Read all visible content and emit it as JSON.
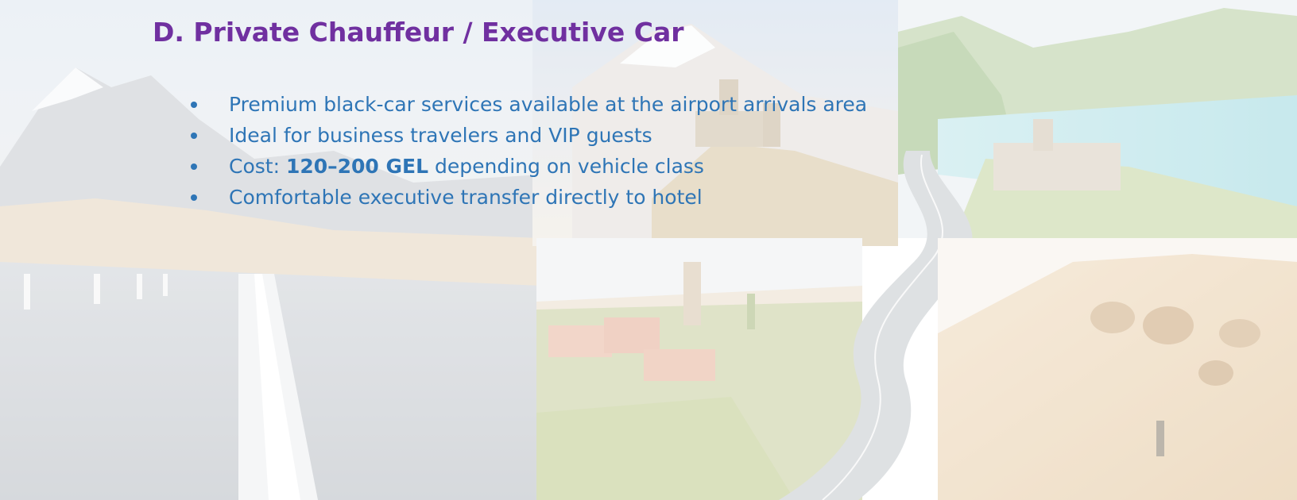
{
  "slide": {
    "title": "D. Private Chauffeur / Executive Car",
    "bullets": [
      "Premium black-car services available at the airport arrivals area",
      "Ideal for business travelers and VIP guests",
      {
        "prefix": "Cost: ",
        "emphasis": "120–200 GEL",
        "suffix": " depending on vehicle class"
      },
      "Comfortable executive transfer directly to hotel"
    ]
  },
  "colors": {
    "title": "#7030a0",
    "bullet_text": "#2e75b6"
  },
  "background": {
    "panels": [
      "road-with-mountains-photo",
      "church-on-hill-photo",
      "lake-fortress-photo",
      "village-photo",
      "winding-road-photo",
      "cave-town-photo"
    ]
  }
}
